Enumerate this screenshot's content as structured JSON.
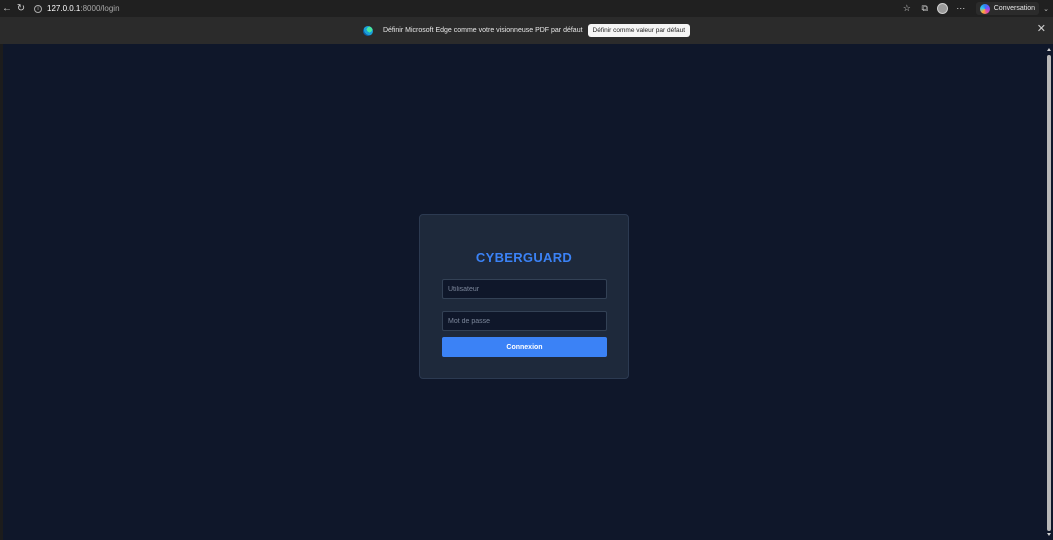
{
  "browser": {
    "url_host": "127.0.0.1",
    "url_path": ":8000/login",
    "copilot_label": "Conversation",
    "icons": [
      "back-arrow-icon",
      "refresh-icon",
      "site-info-icon",
      "favorite-star-icon",
      "collections-icon",
      "profile-avatar-icon",
      "more-options-icon",
      "copilot-icon",
      "chevron-down-icon"
    ]
  },
  "infobar": {
    "message": "Définir Microsoft Edge comme votre visionneuse PDF par défaut",
    "button_label": "Définir comme valeur par défaut",
    "close_glyph": "✕"
  },
  "login": {
    "brand": "CYBERGUARD",
    "username_placeholder": "Utilisateur",
    "password_placeholder": "Mot de passe",
    "submit_label": "Connexion"
  },
  "colors": {
    "page_background": "#0f172a",
    "card_background": "#1e293b",
    "accent": "#3b82f6"
  }
}
